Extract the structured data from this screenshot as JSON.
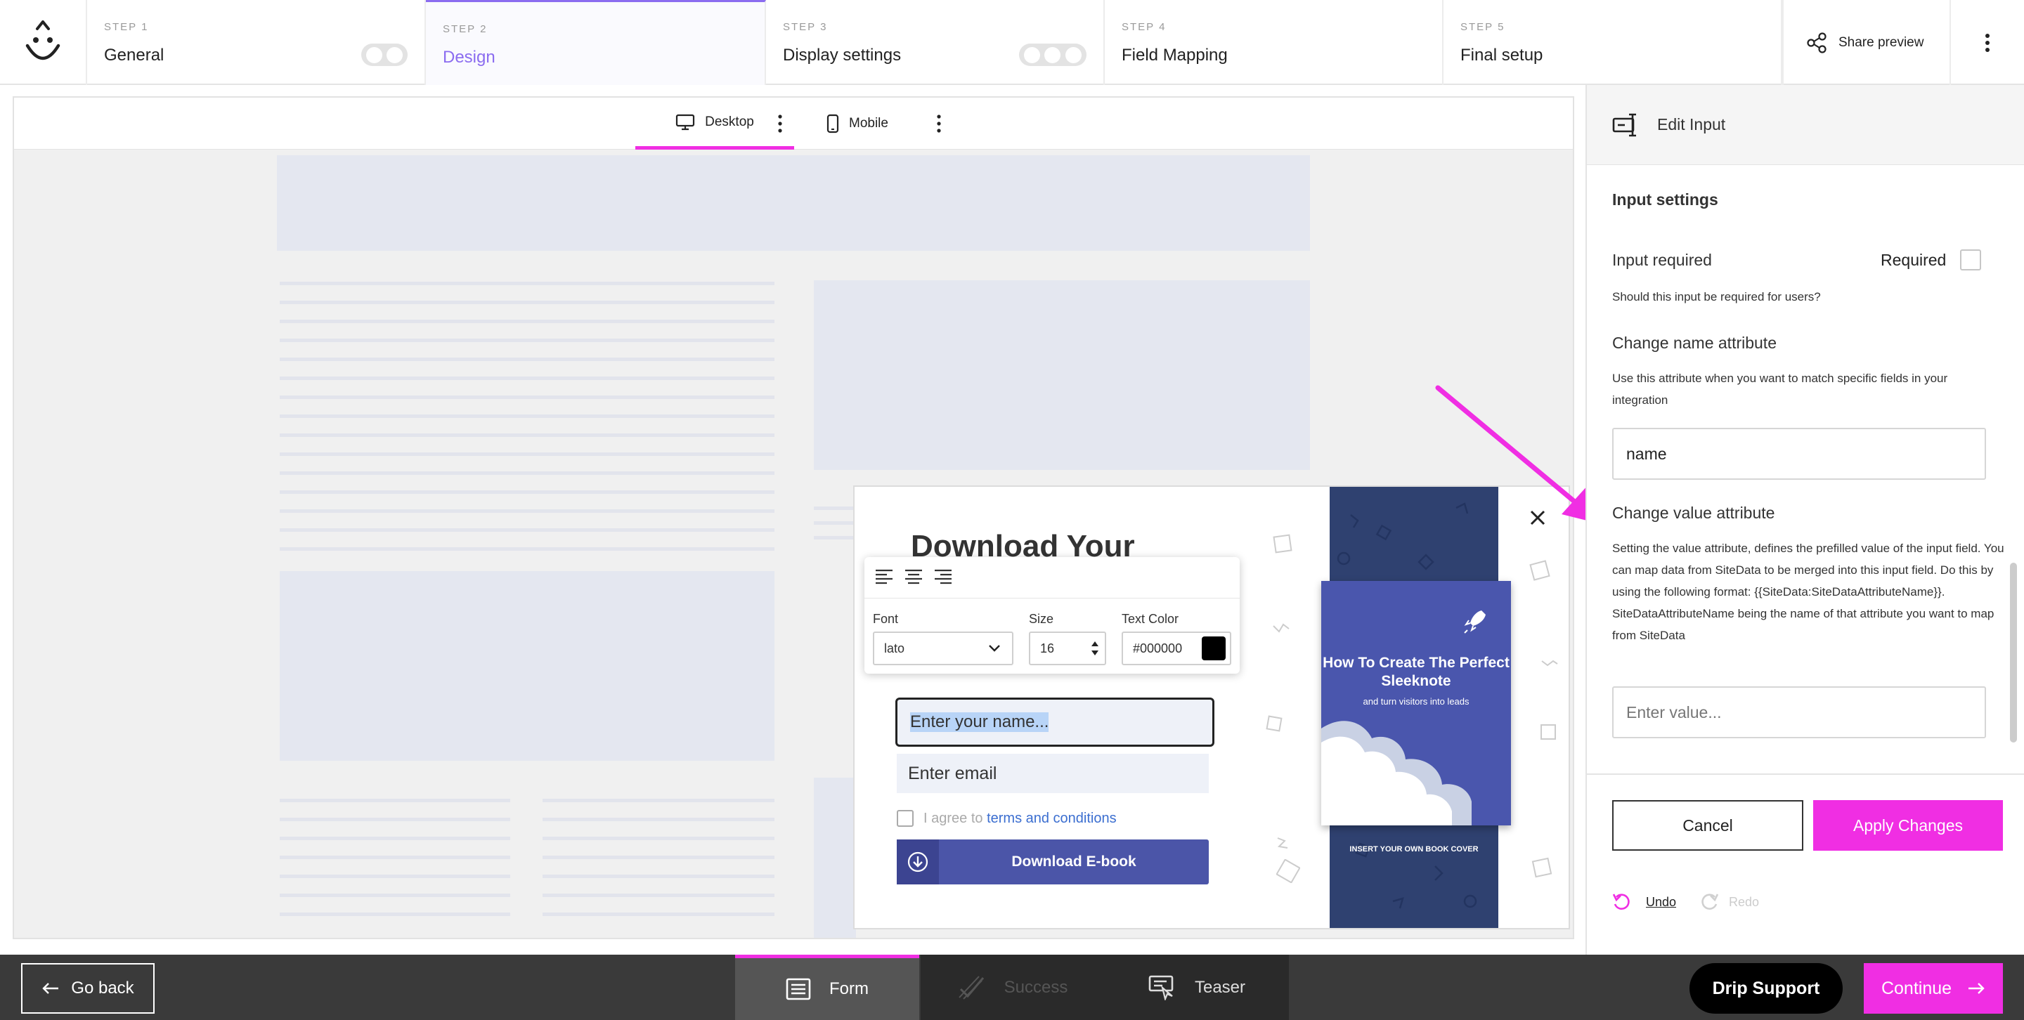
{
  "steps": [
    {
      "num": "STEP 1",
      "label": "General"
    },
    {
      "num": "STEP 2",
      "label": "Design"
    },
    {
      "num": "STEP 3",
      "label": "Display settings"
    },
    {
      "num": "STEP 4",
      "label": "Field Mapping"
    },
    {
      "num": "STEP 5",
      "label": "Final setup"
    }
  ],
  "header": {
    "share_label": "Share preview",
    "more_icon": "more-vertical-icon",
    "logo_icon": "smiley-logo-icon"
  },
  "device_tabs": [
    {
      "label": "Desktop",
      "icon": "desktop-icon"
    },
    {
      "label": "Mobile",
      "icon": "mobile-icon"
    }
  ],
  "popup": {
    "title": "Download Your",
    "name_placeholder": "Enter your name...",
    "email_placeholder": "Enter email",
    "agree_text": "I agree to",
    "agree_link": "terms and conditions",
    "button_label": "Download E-book",
    "book_title": "How To Create The Perfect Sleeknote",
    "book_subtitle": "and turn visitors into leads",
    "book_note": "INSERT YOUR OWN BOOK COVER"
  },
  "text_toolbar": {
    "font_label": "Font",
    "font_value": "lato",
    "size_label": "Size",
    "size_value": "16",
    "color_label": "Text Color",
    "color_value": "#000000",
    "color_swatch": "#000000"
  },
  "panel": {
    "title": "Edit Input",
    "section_title": "Input settings",
    "required_title": "Input required",
    "required_label": "Required",
    "required_help": "Should this input be required for users?",
    "name_attr_title": "Change name attribute",
    "name_attr_help": "Use this attribute when you want to match specific fields in your integration",
    "name_attr_value": "name",
    "value_attr_title": "Change value attribute",
    "value_attr_help": "Setting the value attribute, defines the prefilled value of the input field. You can map data from SiteData to be merged into this input field. Do this by using the following format: {{SiteData:SiteDataAttributeName}}. SiteDataAttributeName being the name of that attribute you want to map from SiteData",
    "value_attr_placeholder": "Enter value...",
    "cancel_label": "Cancel",
    "apply_label": "Apply Changes",
    "undo_label": "Undo",
    "redo_label": "Redo"
  },
  "bottom": {
    "go_back": "Go back",
    "tabs": [
      {
        "label": "Form"
      },
      {
        "label": "Success"
      },
      {
        "label": "Teaser"
      }
    ],
    "support_label": "Drip Support",
    "continue_label": "Continue"
  },
  "colors": {
    "accent": "#f02ee3",
    "step_active": "#8b6cf0",
    "button_blue": "#4b55a8",
    "book_stripe": "#2f4170"
  }
}
